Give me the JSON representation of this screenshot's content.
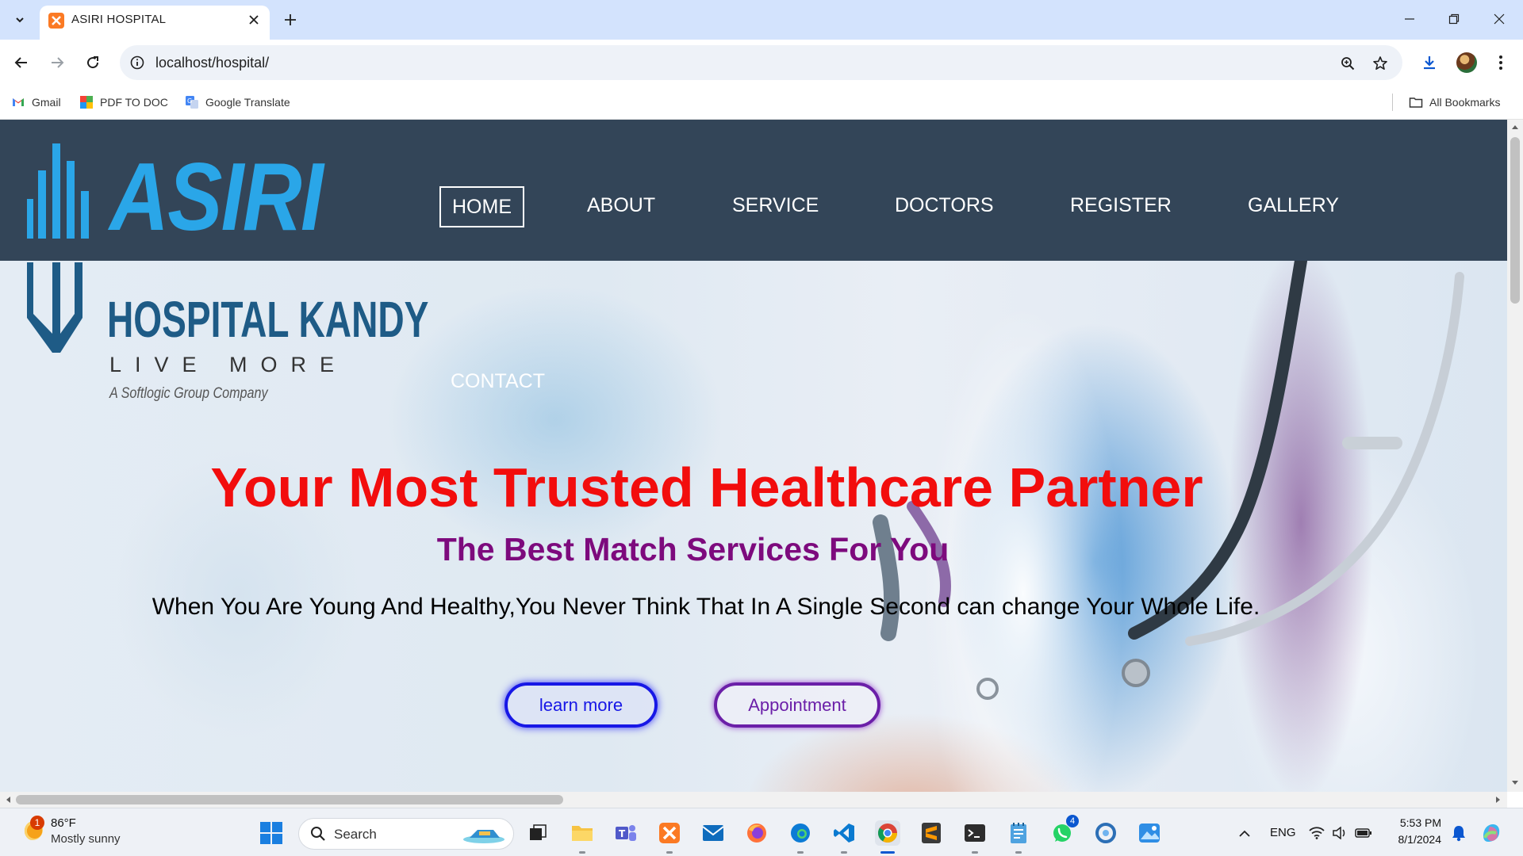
{
  "browser": {
    "tab_title": "ASIRI HOSPITAL",
    "url": "localhost/hospital/",
    "bookmarks": [
      {
        "label": "Gmail",
        "icon": "gmail-icon"
      },
      {
        "label": "PDF TO DOC",
        "icon": "pdf-to-doc-icon"
      },
      {
        "label": "Google Translate",
        "icon": "google-translate-icon"
      }
    ],
    "all_bookmarks_label": "All Bookmarks"
  },
  "site": {
    "logo": {
      "name": "ASIRI",
      "line2": "HOSPITAL KANDY",
      "tagline": "LIVE MORE",
      "company": "A Softlogic Group Company"
    },
    "nav": [
      "HOME",
      "ABOUT",
      "SERVICE",
      "DOCTORS",
      "REGISTER",
      "GALLERY",
      "CONTACT"
    ],
    "active_nav": "HOME",
    "hero": {
      "title": "Your Most Trusted Healthcare Partner",
      "subtitle": "The Best Match Services For You",
      "text": "When You Are Young And Healthy,You Never Think That In A Single Second can change Your Whole Life.",
      "learn_more": "learn more",
      "appointment": "Appointment"
    },
    "colors": {
      "nav_bg": "#334558",
      "title": "#f20d0d",
      "subtitle": "#7d0a7d",
      "learn_more": "#1717e6",
      "appointment": "#6b1fa8",
      "logo_blue": "#2aa6e8"
    }
  },
  "taskbar": {
    "weather_badge": "1",
    "weather_temp": "86°F",
    "weather_desc": "Mostly sunny",
    "search_label": "Search",
    "whatsapp_badge": "4",
    "language": "ENG",
    "time": "5:53 PM",
    "date": "8/1/2024"
  }
}
